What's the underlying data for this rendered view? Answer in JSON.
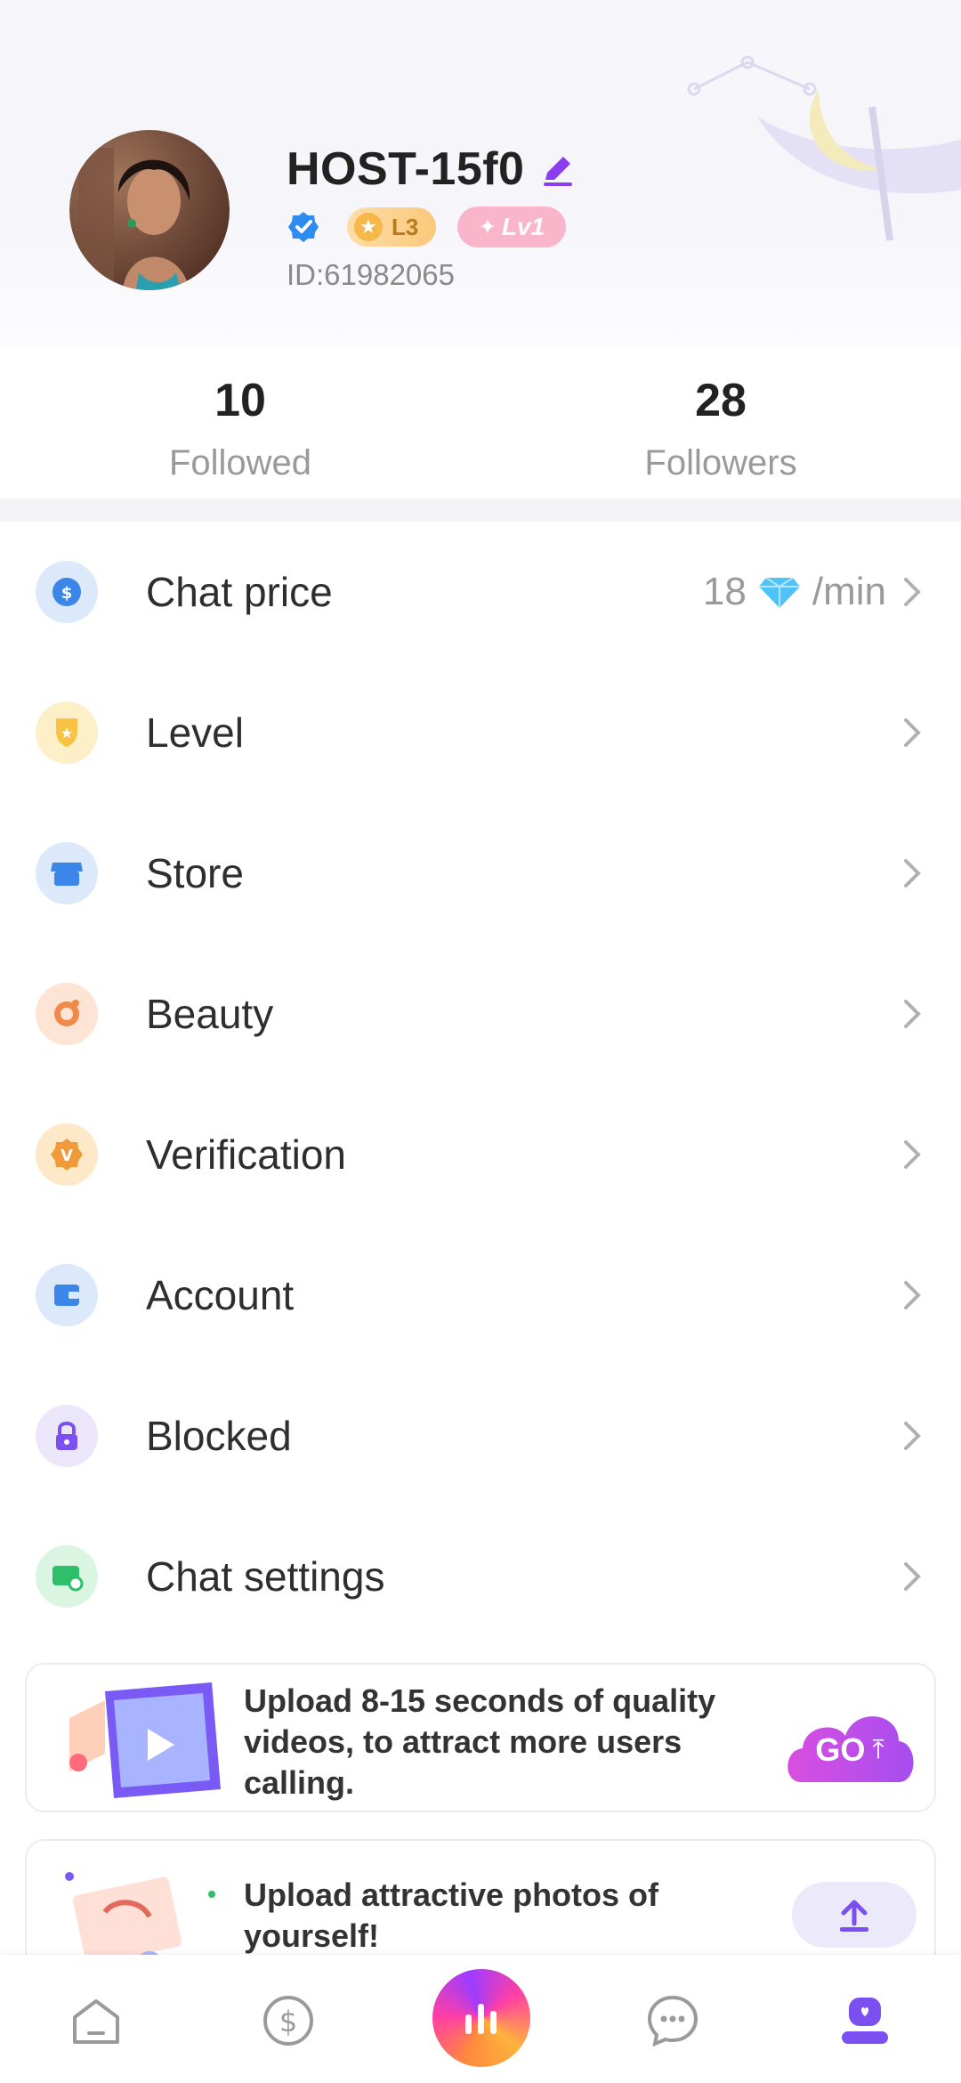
{
  "profile": {
    "username": "HOST-15f0",
    "badges": {
      "l3": "L3",
      "lv1": "Lv1"
    },
    "user_id": "ID:61982065"
  },
  "stats": {
    "followed": {
      "value": "10",
      "label": "Followed"
    },
    "followers": {
      "value": "28",
      "label": "Followers"
    }
  },
  "menu": {
    "chat_price": {
      "label": "Chat price",
      "amount": "18",
      "unit": "/min"
    },
    "items": [
      {
        "label": "Level"
      },
      {
        "label": "Store"
      },
      {
        "label": "Beauty"
      },
      {
        "label": "Verification"
      },
      {
        "label": "Account"
      },
      {
        "label": "Blocked"
      },
      {
        "label": "Chat settings"
      }
    ]
  },
  "cards": {
    "video": {
      "text": "Upload 8-15 seconds of quality videos, to attract more users calling.",
      "button_label": "GO"
    },
    "photos": {
      "text": "Upload attractive photos of yourself!"
    }
  },
  "bottom_nav": [
    "home-icon",
    "dollar-icon",
    "stats-icon",
    "chat-icon",
    "profile-icon"
  ],
  "colors": {
    "accent_purple": "#7b4ff0",
    "go_gradient": [
      "#d94fe0",
      "#a64df0"
    ],
    "verified_blue": "#2d8cf0"
  }
}
